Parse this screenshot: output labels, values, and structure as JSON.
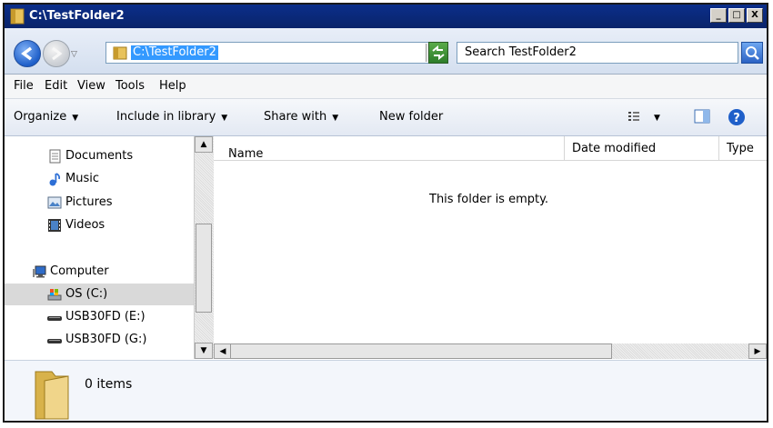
{
  "window": {
    "title": "C:\\TestFolder2",
    "controls": {
      "minimize": "_",
      "maximize": "□",
      "close": "X"
    }
  },
  "navbar": {
    "address": "C:\\TestFolder2",
    "search_placeholder": "Search TestFolder2"
  },
  "menu": [
    {
      "label": "File",
      "mnemonic": "F"
    },
    {
      "label": "Edit",
      "mnemonic": "E"
    },
    {
      "label": "View",
      "mnemonic": "V"
    },
    {
      "label": "Tools",
      "mnemonic": "T"
    },
    {
      "label": "Help",
      "mnemonic": "H"
    }
  ],
  "toolbar": {
    "organize": "Organize",
    "include_library": "Include in library",
    "share_with": "Share with",
    "new_folder": "New folder"
  },
  "navpane": {
    "items": [
      {
        "label": "Documents",
        "icon": "documents-icon"
      },
      {
        "label": "Music",
        "icon": "music-icon"
      },
      {
        "label": "Pictures",
        "icon": "pictures-icon"
      },
      {
        "label": "Videos",
        "icon": "videos-icon"
      },
      {
        "label": "Computer",
        "icon": "computer-icon"
      },
      {
        "label": "OS (C:)",
        "icon": "drive-c-icon",
        "selected": true
      },
      {
        "label": "USB30FD (E:)",
        "icon": "usb-drive-icon"
      },
      {
        "label": "USB30FD (G:)",
        "icon": "usb-drive-icon"
      }
    ]
  },
  "content": {
    "columns": [
      "Name",
      "Date modified",
      "Type"
    ],
    "empty_message": "This folder is empty."
  },
  "details": {
    "count": "0 items"
  },
  "colors": {
    "title_bar": "#0a246a",
    "selection": "#3399ff",
    "nav_selected": "#d9d9d9"
  }
}
